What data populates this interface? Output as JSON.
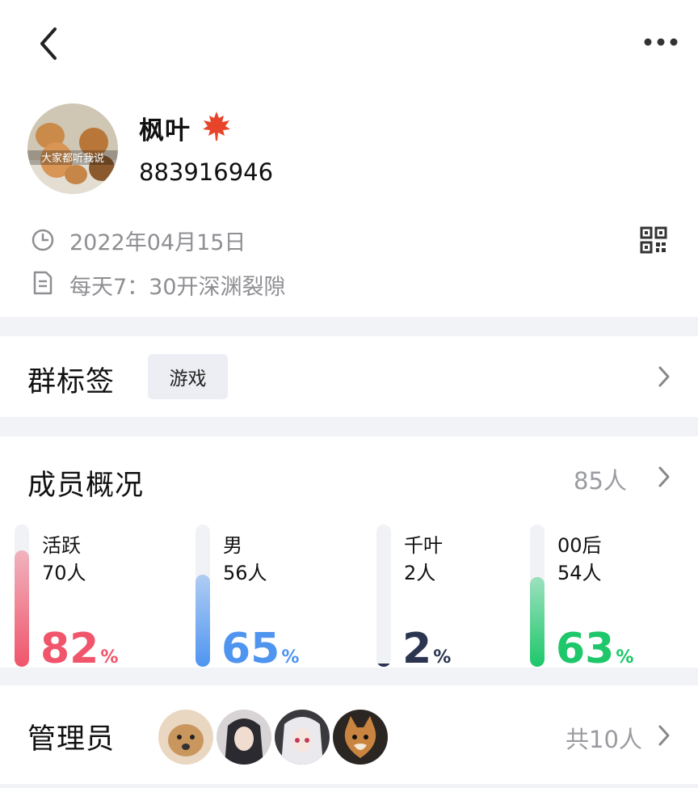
{
  "group": {
    "name": "枫叶",
    "id": "883916946",
    "created_date": "2022年04月15日",
    "description": "每天7：30开深渊裂隙",
    "avatar_caption": "大家都听我说"
  },
  "tags_section": {
    "title": "群标签",
    "tags": [
      "游戏"
    ]
  },
  "members_section": {
    "title": "成员概况",
    "count_label": "85人",
    "stats": [
      {
        "label": "活跃",
        "count": "70人",
        "percent": "82",
        "fill": 0.82,
        "color": "#f0556b"
      },
      {
        "label": "男",
        "count": "56人",
        "percent": "65",
        "fill": 0.65,
        "color": "#4f95f0"
      },
      {
        "label": "千叶",
        "count": "2人",
        "percent": "2",
        "fill": 0.02,
        "color": "#2b3550"
      },
      {
        "label": "00后",
        "count": "54人",
        "percent": "63",
        "fill": 0.63,
        "color": "#1dc76a"
      }
    ],
    "percent_unit": "%"
  },
  "admins_section": {
    "title": "管理员",
    "count_label": "共10人"
  },
  "icons": [
    "back-icon",
    "more-icon",
    "maple-leaf-icon",
    "clock-icon",
    "qr-code-icon",
    "document-icon",
    "chevron-right-icon"
  ]
}
